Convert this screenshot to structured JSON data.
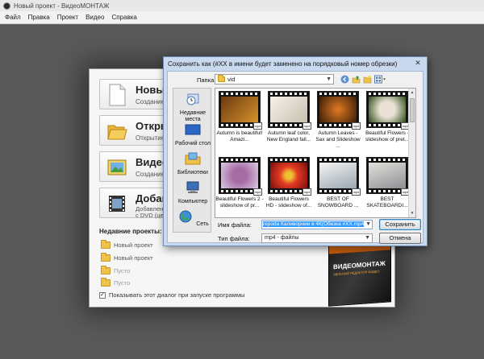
{
  "window": {
    "title": "Новый проект - ВидеоМОНТАЖ",
    "menu": [
      "Файл",
      "Правка",
      "Проект",
      "Видео",
      "Справка"
    ]
  },
  "welcome": {
    "buttons": [
      {
        "title": "Новый п",
        "subtitle": "Создание н"
      },
      {
        "title": "Открыт",
        "subtitle": "Открытие р"
      },
      {
        "title": "Видео-о",
        "subtitle": "Создание н"
      },
      {
        "title": "Добавит",
        "subtitle_line1": "Добавление",
        "subtitle_line2": "с DVD (цели"
      }
    ],
    "recent_title": "Недавние проекты:",
    "recent": [
      "Новый проект",
      "Новый проект",
      "Пусто",
      "Пусто"
    ],
    "show_dialog_label": "Показывать этот диалог при запуске программы",
    "product_name": "ВИДЕОМОНТАЖ",
    "product_tagline": "УДОБНЫЙ РЕДАКТОР ВИДЕО"
  },
  "save_dialog": {
    "title": "Сохранить как (#XX в имени будет заменено на порядковый номер обрезки)",
    "folder_label": "Папка:",
    "folder_value": "vid",
    "places": [
      "Недавние места",
      "Рабочий стол",
      "Библиотеки",
      "Компьютер",
      "Сеть"
    ],
    "files": [
      {
        "name": "Autumn is beautiful! Amazi...",
        "colors": [
          "#6b3a12",
          "#d7922a"
        ]
      },
      {
        "name": "Autumn leaf color, New England fall...",
        "colors": [
          "#f6f2ea",
          "#c8c0b0"
        ]
      },
      {
        "name": "Autumn Leaves - Sax and Slideshow ...",
        "colors": [
          "#3a1d08",
          "#c9641a"
        ]
      },
      {
        "name": "Beautiful Flowers - slideshow of pret...",
        "colors": [
          "#2d4a1a",
          "#e9e2d4"
        ]
      },
      {
        "name": "Beautiful Flowers 2 - slideshow of pr...",
        "colors": [
          "#d9cde2",
          "#a66aa4"
        ]
      },
      {
        "name": "Beautiful Flowers HD - slideshow of...",
        "colors": [
          "#7a0d0d",
          "#e23a24"
        ]
      },
      {
        "name": "BEST OF SNOWBOARD ...",
        "colors": [
          "#f4f4f4",
          "#9aa7b0"
        ]
      },
      {
        "name": "BEST SKATEBOARDI...",
        "colors": [
          "#e4e1dc",
          "#8d8f93"
        ]
      }
    ],
    "filename_label": "Имя файла:",
    "filename_value": "rероda Каливорнии в 4К(Обезка #XX.mp4",
    "filetype_label": "Тип файла:",
    "filetype_value": "mp4 - файлы",
    "save_button": "Сохранить",
    "cancel_button": "Отмена"
  }
}
